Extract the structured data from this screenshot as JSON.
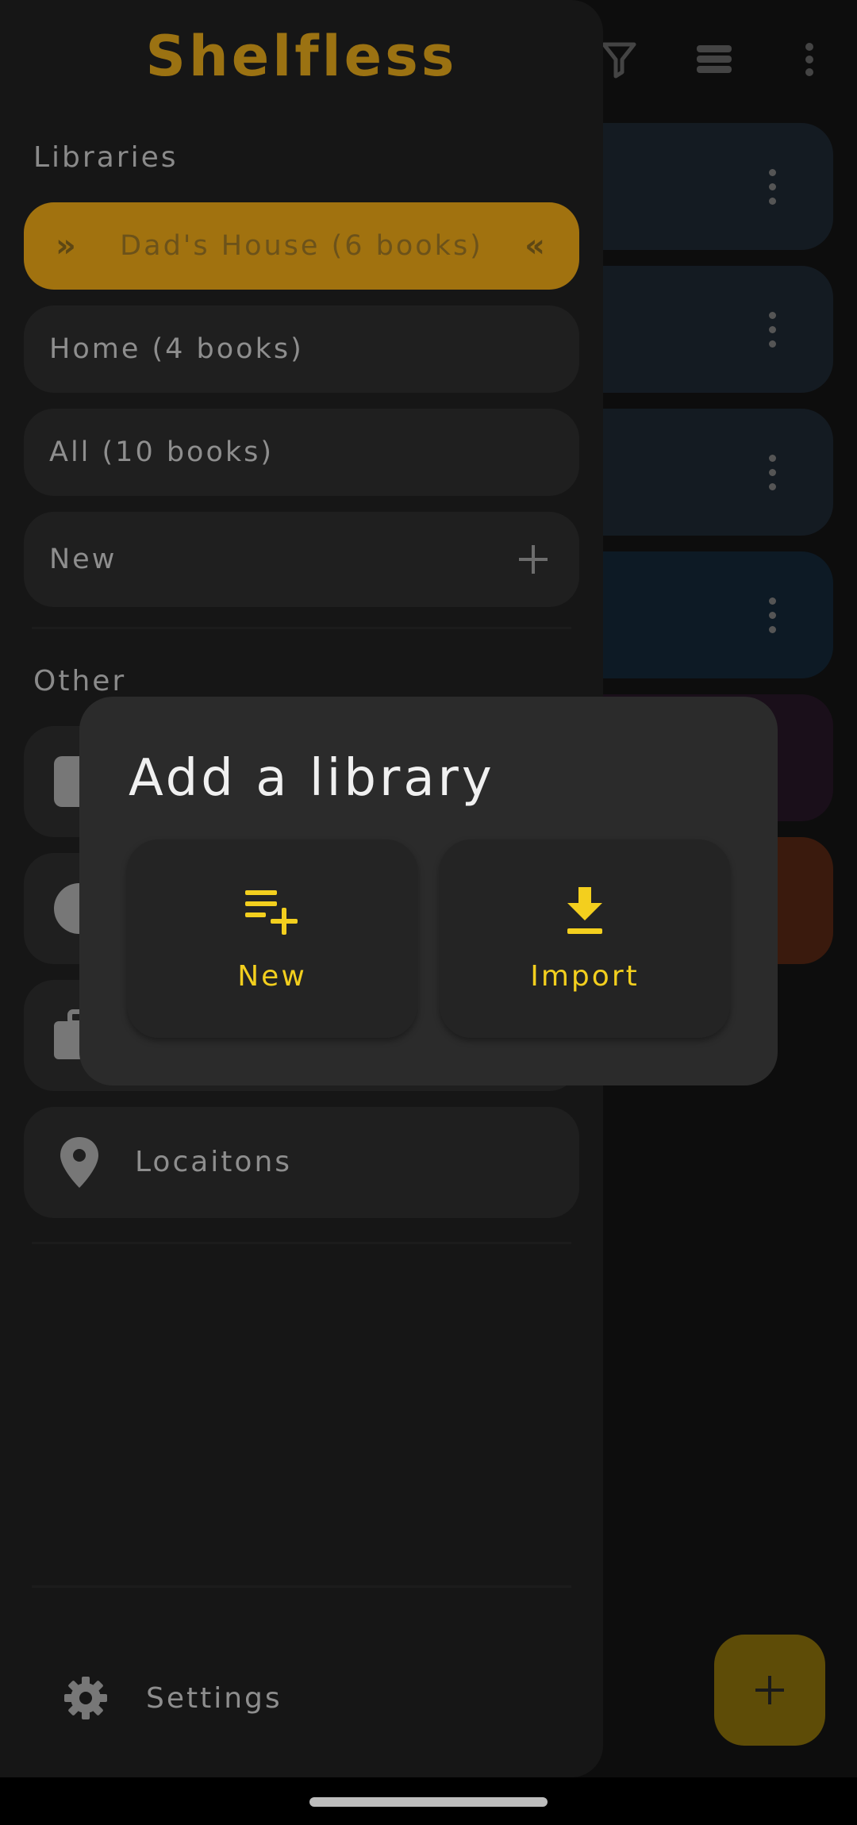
{
  "app": {
    "title": "Shelfless"
  },
  "drawer": {
    "libraries_label": "Libraries",
    "libraries": [
      {
        "label": "Dad's House (6 books)",
        "selected": true
      },
      {
        "label": "Home (4 books)",
        "selected": false
      },
      {
        "label": "All (10 books)",
        "selected": false
      }
    ],
    "new_library_label": "New",
    "other_label": "Other",
    "other_items": [
      {
        "label": "",
        "icon": "contact-icon"
      },
      {
        "label": "",
        "icon": "palette-icon"
      },
      {
        "label": "",
        "icon": "briefcase-icon"
      },
      {
        "label": "Locaitons",
        "icon": "location-pin-icon"
      }
    ],
    "settings_label": "Settings"
  },
  "dialog": {
    "title": "Add a library",
    "options": [
      {
        "label": "New",
        "icon": "playlist-add-icon"
      },
      {
        "label": "Import",
        "icon": "download-icon"
      }
    ]
  },
  "colors": {
    "accent": "#f3cf1e",
    "title": "#9b7212",
    "selected_library": "#a1720f",
    "drawer": "#161616",
    "dialog": "#2b2b2b"
  }
}
